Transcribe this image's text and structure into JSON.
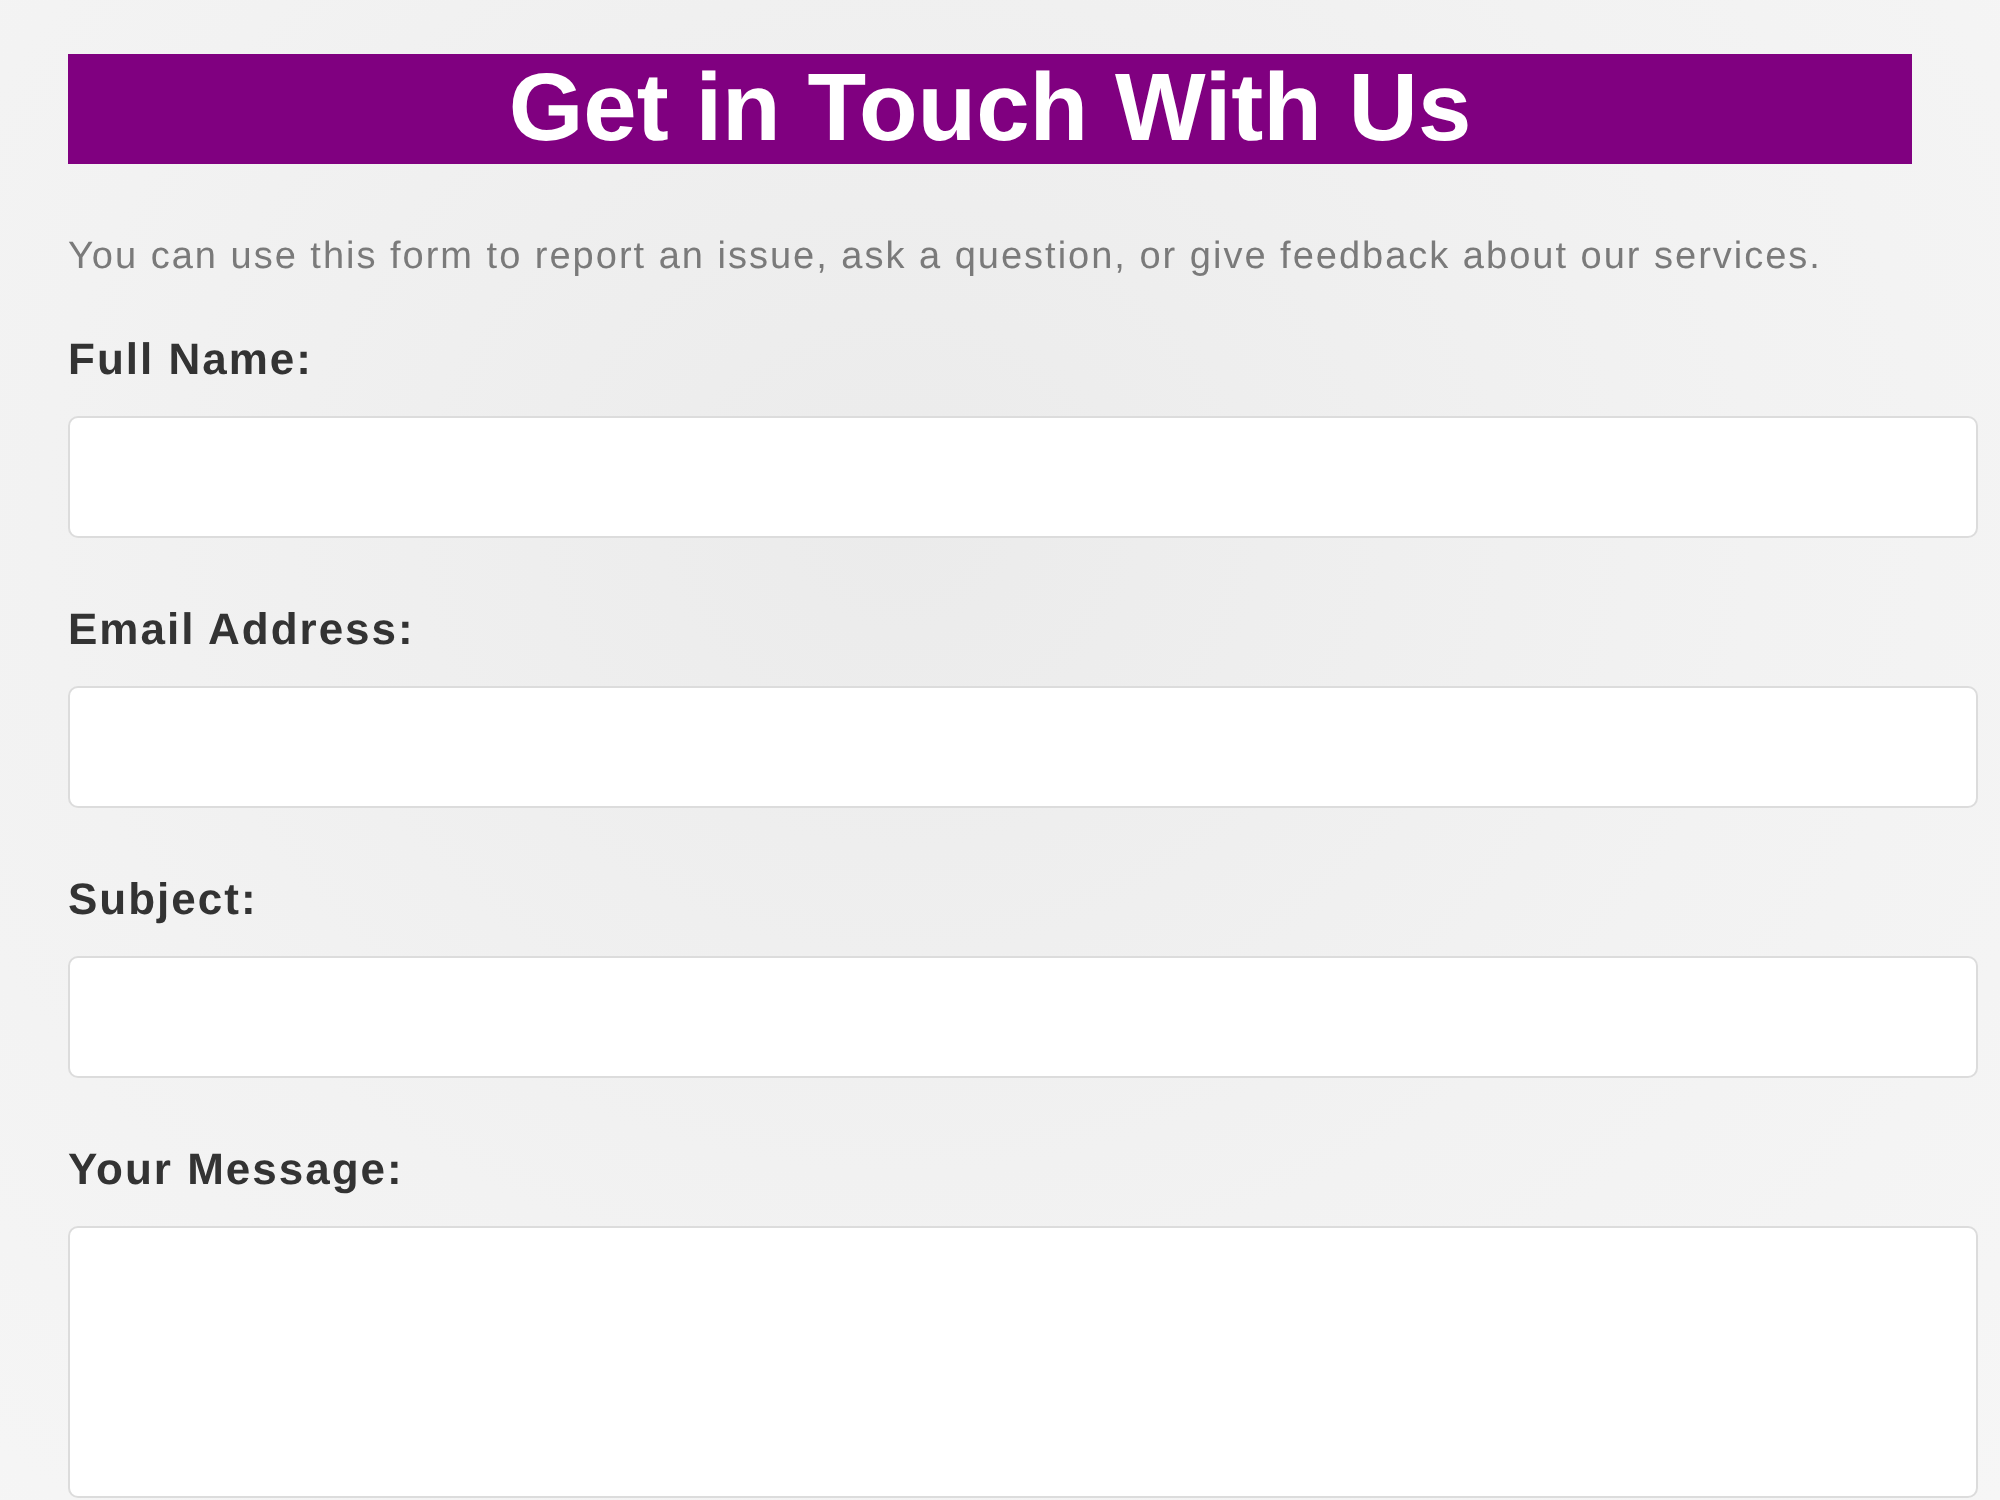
{
  "header": {
    "title": "Get in Touch With Us"
  },
  "intro": "You can use this form to report an issue, ask a question, or give feedback about our services.",
  "fields": [
    {
      "label": "Full Name:",
      "kind": "input"
    },
    {
      "label": "Email Address:",
      "kind": "input"
    },
    {
      "label": "Subject:",
      "kind": "input"
    },
    {
      "label": "Your Message:",
      "kind": "textarea"
    }
  ]
}
